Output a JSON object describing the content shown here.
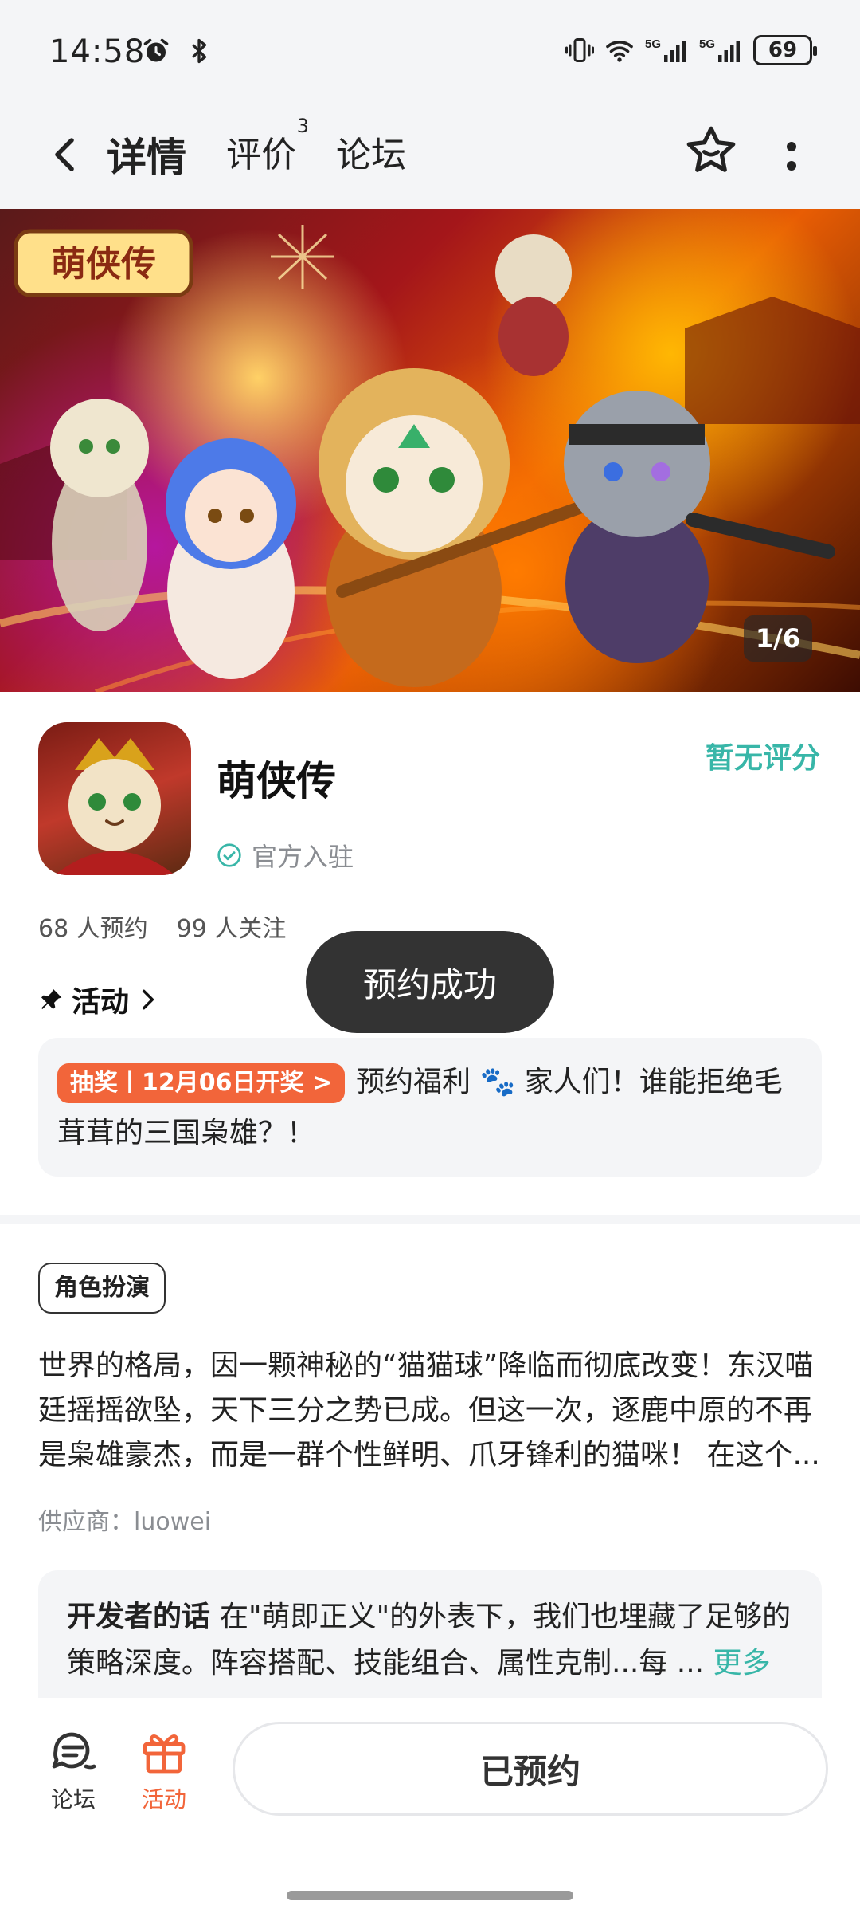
{
  "status_bar": {
    "time": "14:58",
    "battery": "69",
    "icons": [
      "alarm-icon",
      "bluetooth-icon",
      "vibrate-icon",
      "wifi-icon",
      "signal-5g-icon",
      "signal-5g-icon"
    ]
  },
  "header": {
    "tabs": [
      {
        "label": "详情",
        "active": true
      },
      {
        "label": "评价",
        "badge": "3"
      },
      {
        "label": "论坛"
      }
    ]
  },
  "banner": {
    "logo_text": "萌侠传",
    "page_indicator": "1/6"
  },
  "app": {
    "name": "萌侠传",
    "rating": "暂无评分",
    "official": "官方入驻",
    "reservations": "68 人预约",
    "followers": "99 人关注"
  },
  "toast": "预约成功",
  "activity": {
    "heading": "活动",
    "tag": "抽奖丨12月06日开奖 >",
    "text": "预约福利 🐾 家人们！谁能拒绝毛茸茸的三国枭雄？！"
  },
  "genre": "角色扮演",
  "description": "世界的格局，因一颗神秘的“猫猫球”降临而彻底改变！东汉喵廷摇摇欲坠，天下三分之势已成。但这一次，逐鹿中原的不再是枭雄豪杰，而是一群个性鲜明、爪牙锋利的猫咪！ 在这个...",
  "supplier": "供应商：luowei",
  "developer": {
    "title": "开发者的话",
    "text": "在\"萌即正义\"的外表下，我们也埋藏了足够的策略深度。阵容搭配、技能组合、属性克制...每 ...",
    "more": "更多"
  },
  "bottom_bar": {
    "forum": "论坛",
    "activity": "活动",
    "reserved": "已预约"
  },
  "colors": {
    "accent": "#38b6a8",
    "tab_underline": "#2ec4b6",
    "orange": "#f2653a"
  }
}
